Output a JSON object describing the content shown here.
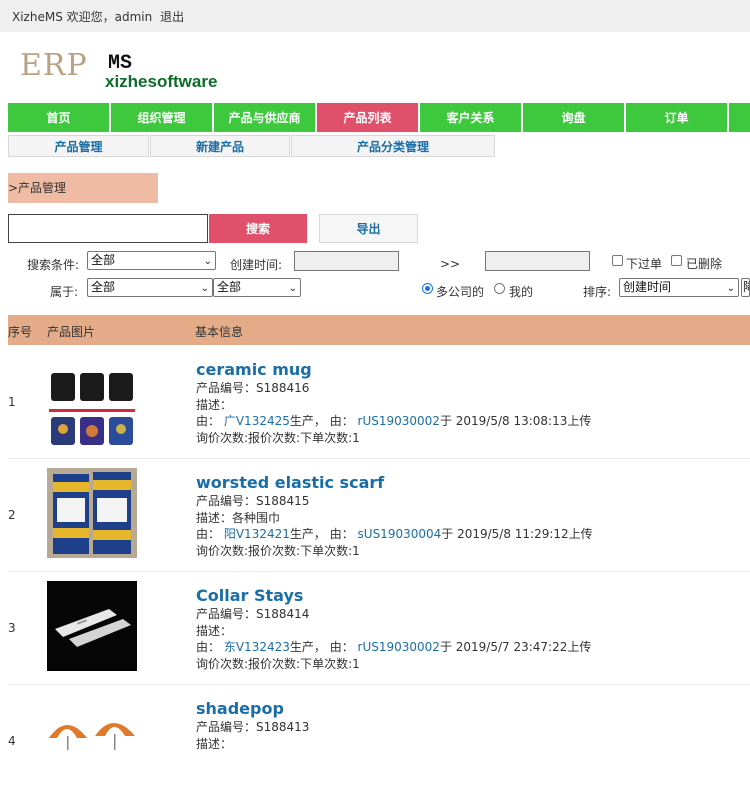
{
  "topbar": {
    "welcome": "XizheMS 欢迎您，admin",
    "logout": "退出"
  },
  "logo": {
    "erp": "ERP",
    "ms": "MS",
    "company": "xizhesoftware"
  },
  "nav": [
    {
      "label": "首页"
    },
    {
      "label": "组织管理"
    },
    {
      "label": "产品与供应商"
    },
    {
      "label": "产品列表",
      "active": true
    },
    {
      "label": "客户关系"
    },
    {
      "label": "询盘"
    },
    {
      "label": "订单"
    }
  ],
  "subnav": [
    {
      "label": "产品管理"
    },
    {
      "label": "新建产品"
    },
    {
      "label": "产品分类管理"
    }
  ],
  "breadcrumb": ">产品管理",
  "search": {
    "value": "",
    "button": "搜索",
    "export": "导出"
  },
  "filters": {
    "condition_label": "搜索条件:",
    "condition_value": "全部",
    "created_label": "创建时间:",
    "range_sep": ">>",
    "ordered_label": "下过单",
    "deleted_label": "已删除",
    "belong_label": "属于:",
    "belong_value_1": "全部",
    "belong_value_2": "全部",
    "scope_all": "多公司的",
    "scope_mine": "我的",
    "sort_label": "排序:",
    "sort_value": "创建时间",
    "sort_extra": "降"
  },
  "table": {
    "headers": {
      "index": "序号",
      "image": "产品图片",
      "info": "基本信息"
    },
    "rows": [
      {
        "index": "1",
        "title": "ceramic mug",
        "code": "产品编号：S188416",
        "desc": "描述：",
        "by1": "由：",
        "factory": "广V132425",
        "produced": "生产，  由：",
        "uploader": "rUS19030002",
        "uploaded": "于 2019/5/8 13:08:13上传",
        "stats": "询价次数:报价次数:下单次数:1",
        "image_icon": "mug-photo-icon"
      },
      {
        "index": "2",
        "title": "worsted elastic scarf",
        "code": "产品编号：S188415",
        "desc": "描述：各种围巾",
        "by1": "由：",
        "factory": "阳V132421",
        "produced": "生产，  由：",
        "uploader": "sUS19030004",
        "uploaded": "于 2019/5/8 11:29:12上传",
        "stats": "询价次数:报价次数:下单次数:1",
        "image_icon": "scarf-photo-icon"
      },
      {
        "index": "3",
        "title": "Collar Stays",
        "code": "产品编号：S188414",
        "desc": "描述：",
        "by1": "由：",
        "factory": "东V132423",
        "produced": "生产，  由：",
        "uploader": "rUS19030002",
        "uploaded": "于 2019/5/7 23:47:22上传",
        "stats": "询价次数:报价次数:下单次数:1",
        "image_icon": "collar-stays-photo-icon"
      },
      {
        "index": "4",
        "title": "shadepop",
        "code": "产品编号：S188413",
        "desc": "描述：",
        "image_icon": "umbrella-photo-icon"
      }
    ]
  }
}
